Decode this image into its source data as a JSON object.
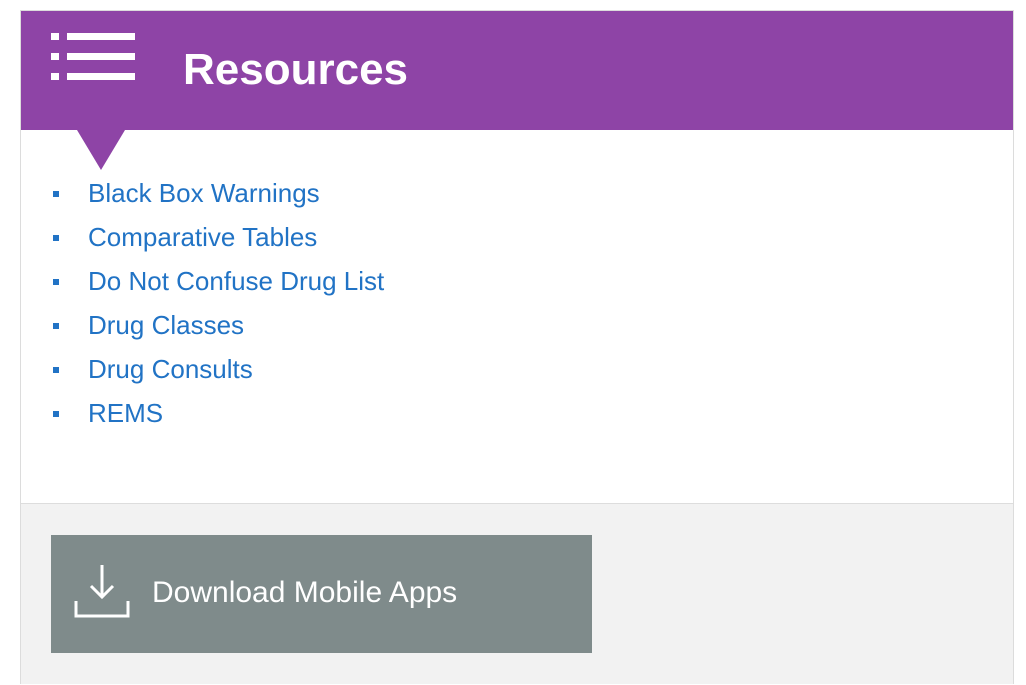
{
  "colors": {
    "accent": "#8e44a6",
    "link": "#2173c5"
  },
  "header": {
    "title": "Resources",
    "icon": "list-icon"
  },
  "resources": {
    "items": [
      {
        "label": "Black Box Warnings"
      },
      {
        "label": "Comparative Tables"
      },
      {
        "label": "Do Not Confuse Drug List"
      },
      {
        "label": "Drug Classes"
      },
      {
        "label": "Drug Consults"
      },
      {
        "label": "REMS"
      }
    ]
  },
  "footer": {
    "download_label": "Download Mobile Apps",
    "download_icon": "download-icon"
  }
}
